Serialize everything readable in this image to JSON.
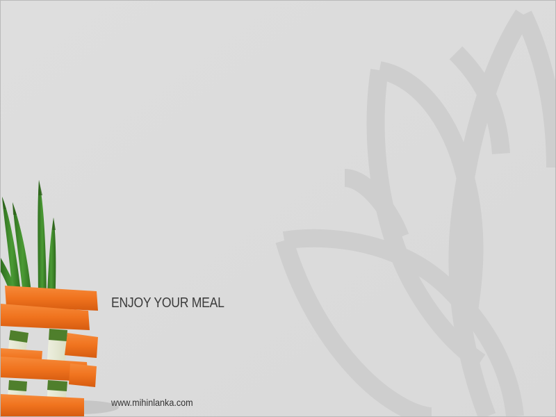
{
  "colors": {
    "background": "#dcdcdc",
    "lotus_watermark": "#cecece",
    "text": "#3c3c3c",
    "carrot": "#f0731e",
    "asparagus": "#3e8a2c",
    "zucchini": "#5f8e3a"
  },
  "tagline": "ENJOY YOUR MEAL",
  "website": "www.mihinlanka.com"
}
